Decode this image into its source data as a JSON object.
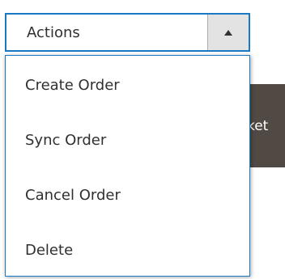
{
  "dropdown": {
    "label": "Actions",
    "items": [
      {
        "label": "Create Order"
      },
      {
        "label": "Sync Order"
      },
      {
        "label": "Cancel Order"
      },
      {
        "label": "Delete"
      }
    ]
  },
  "background_button": {
    "label": "rket"
  },
  "colors": {
    "border_active": "#1979c3",
    "text": "#303030",
    "arrow_bg": "#e3e3e3",
    "background_button": "#514943"
  }
}
